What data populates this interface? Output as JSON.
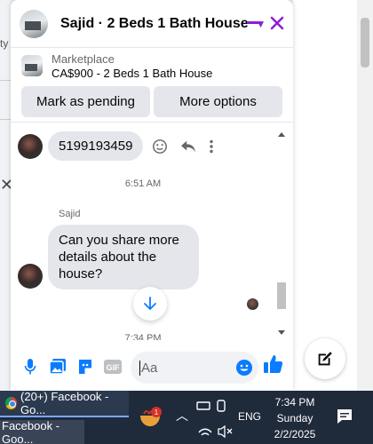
{
  "background": {
    "left_text": "ty"
  },
  "chat": {
    "title": "Sajid · 2 Beds 1 Bath House",
    "marketplace_label": "Marketplace",
    "listing": "CA$900 - 2 Beds 1 Bath House",
    "actions": [
      "Mark as pending",
      "More options"
    ],
    "messages": {
      "first_bubble": "5199193459",
      "time1": "6:51 AM",
      "sender": "Sajid",
      "second_bubble": "Can you share more details about the house?",
      "time2": "7:34 PM"
    },
    "composer": {
      "placeholder": "Aa"
    },
    "accent_color": "#8b1fd6",
    "messenger_blue": "#0a7cff"
  },
  "taskbar": {
    "app1": "(20+) Facebook - Go...",
    "app2": "Facebook - Goo...",
    "badge": "1",
    "language": "ENG",
    "time": "7:34 PM",
    "day": "Sunday",
    "date": "2/2/2025"
  }
}
